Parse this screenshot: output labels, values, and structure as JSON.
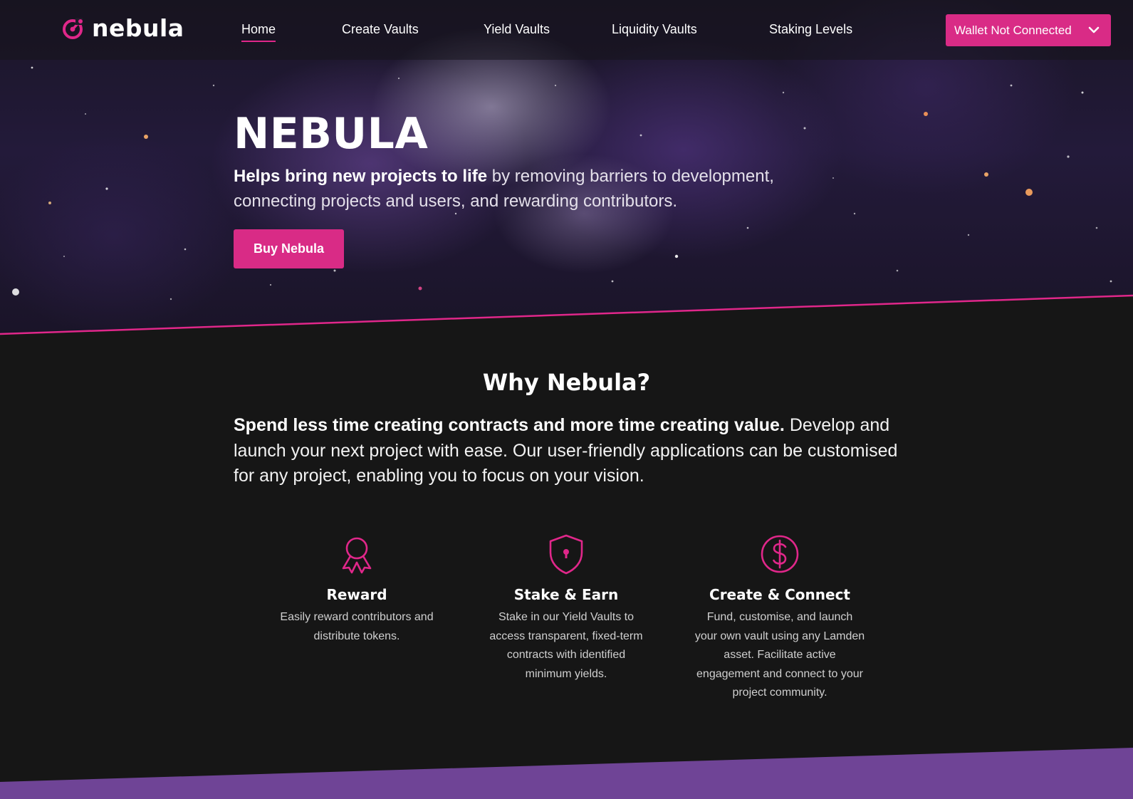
{
  "colors": {
    "accent": "#d92b86",
    "background": "#161616",
    "band": "#6f4496"
  },
  "nav": {
    "logo_text": "nebula",
    "links": [
      {
        "label": "Home",
        "active": true
      },
      {
        "label": "Create Vaults"
      },
      {
        "label": "Yield Vaults"
      },
      {
        "label": "Liquidity Vaults"
      },
      {
        "label": "Staking Levels"
      }
    ],
    "wallet_label": "Wallet Not Connected",
    "wallet_icon": "chevron-down-icon"
  },
  "hero": {
    "title": "NEBULA",
    "subtitle_bold": "Helps bring new projects to life",
    "subtitle_rest": " by removing barriers to development, connecting projects and users, and rewarding contributors.",
    "cta_label": "Buy Nebula"
  },
  "why": {
    "title": "Why Nebula?",
    "text_bold": "Spend less time creating contracts and more time creating value.",
    "text_rest": " Develop and launch your next project with ease. Our user-friendly applications can be customised for any project, enabling you to focus on your vision."
  },
  "features": [
    {
      "icon": "award-ribbon-icon",
      "title": "Reward",
      "description": "Easily reward contributors and distribute tokens."
    },
    {
      "icon": "shield-lock-icon",
      "title": "Stake & Earn",
      "description": "Stake in our Yield Vaults to access transparent, fixed-term contracts with identified minimum yields."
    },
    {
      "icon": "dollar-circle-icon",
      "title": "Create & Connect",
      "description": "Fund, customise, and launch your own vault using any Lamden asset. Facilitate active engagement and connect to your project community."
    }
  ]
}
